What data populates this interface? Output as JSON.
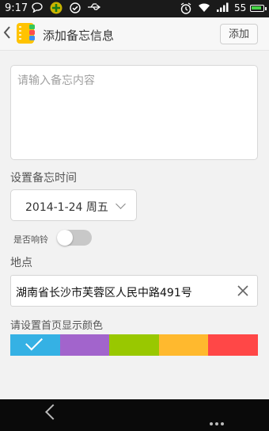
{
  "status_bar": {
    "time": "9:17",
    "signal_number": "55",
    "battery_level": 0.9,
    "icons": [
      "chat-bubble-icon",
      "app-badge-icon",
      "check-circle-icon",
      "usb-icon",
      "alarm-icon",
      "wifi-icon",
      "signal-icon",
      "battery-icon"
    ]
  },
  "header": {
    "back_icon": "chevron-left-icon",
    "app_icon": "notebook-icon",
    "title": "添加备忘信息",
    "add_button": "添加"
  },
  "memo": {
    "placeholder": "请输入备忘内容",
    "value": ""
  },
  "time_section": {
    "label": "设置备忘时间",
    "date_value": "2014-1-24 周五"
  },
  "ring": {
    "label": "是否响铃",
    "enabled": false
  },
  "location": {
    "label": "地点",
    "value": "湖南省长沙市芙蓉区人民中路491号"
  },
  "color_section": {
    "label": "请设置首页显示颜色",
    "colors": [
      "#35b1e4",
      "#a264cc",
      "#99c800",
      "#ffb92e",
      "#ff4747"
    ],
    "selected_index": 0
  },
  "nav_bar": {
    "icons": [
      "back-icon",
      "menu-icon"
    ]
  }
}
